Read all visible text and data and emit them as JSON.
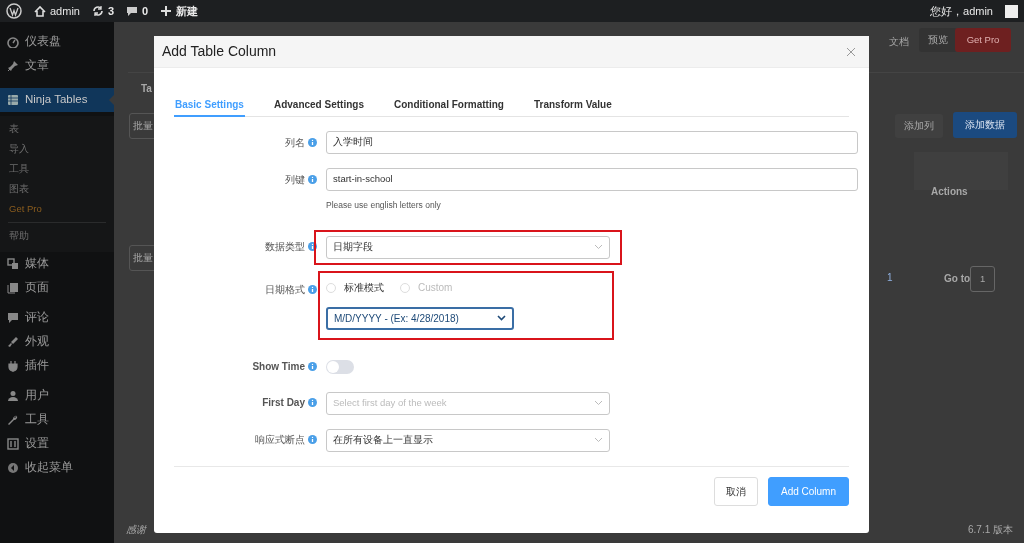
{
  "admin_bar": {
    "items": [
      {
        "kind": "home",
        "label": "admin"
      },
      {
        "kind": "updates",
        "label": "3"
      },
      {
        "kind": "comments",
        "label": "0"
      },
      {
        "kind": "new",
        "label": "新建"
      }
    ],
    "greeting": "您好，admin"
  },
  "sidebar": {
    "items": [
      {
        "kind": "dashboard",
        "label": "仪表盘",
        "selected": false
      },
      {
        "kind": "pin",
        "label": "文章",
        "selected": false
      },
      {
        "kind": "table",
        "label": "Ninja Tables",
        "selected": true,
        "children": [
          {
            "label": "表",
            "kind": "plain"
          },
          {
            "label": "导入",
            "kind": "plain"
          },
          {
            "label": "工具",
            "kind": "plain"
          },
          {
            "label": "图表",
            "kind": "plain"
          },
          {
            "label": "Get Pro",
            "kind": "pro"
          },
          {
            "label": "帮助",
            "kind": "plain"
          }
        ]
      },
      {
        "kind": "media",
        "label": "媒体",
        "selected": false
      },
      {
        "kind": "page",
        "label": "页面",
        "selected": false
      },
      {
        "kind": "comment",
        "label": "评论",
        "selected": false
      },
      {
        "kind": "brush",
        "label": "外观",
        "selected": false
      },
      {
        "kind": "plug",
        "label": "插件",
        "selected": false
      },
      {
        "kind": "user",
        "label": "用户",
        "selected": false
      },
      {
        "kind": "wrench",
        "label": "工具",
        "selected": false
      },
      {
        "kind": "settings",
        "label": "设置",
        "selected": false
      },
      {
        "kind": "collapse",
        "label": "收起菜单",
        "selected": false
      }
    ]
  },
  "background": {
    "header_links": [
      "文档",
      "预览"
    ],
    "pro_button": "Get Pro",
    "tab_fragment": "Ta",
    "bulk_fragments": [
      "批量",
      "批量"
    ],
    "add_column_button": "添加列",
    "add_data_button": "添加数据",
    "column_header": "Actions",
    "page_number": "1",
    "goto_label": "Go to",
    "goto_value": "1",
    "footer_fragment": "感谢",
    "version": "6.7.1 版本"
  },
  "modal": {
    "title": "Add Table Column",
    "tabs": [
      {
        "label": "Basic Settings",
        "selected": true
      },
      {
        "label": "Advanced Settings",
        "selected": false
      },
      {
        "label": "Conditional Formatting",
        "selected": false
      },
      {
        "label": "Transform Value",
        "selected": false
      }
    ],
    "fields": [
      {
        "kind": "text",
        "label": "列名",
        "value": "入学时间"
      },
      {
        "kind": "text",
        "label": "列键",
        "value": "start-in-school",
        "hint": "Please use english letters only"
      },
      {
        "kind": "select",
        "label": "数据类型",
        "value": "日期字段",
        "highlighted": true
      },
      {
        "kind": "date_format",
        "label": "日期格式",
        "highlighted": true,
        "options": [
          {
            "label": "标准模式",
            "selected": false,
            "disabled": false
          },
          {
            "label": "Custom",
            "selected": false,
            "disabled": true
          }
        ],
        "format": "M/D/YYYY - (Ex: 4/28/2018)"
      },
      {
        "kind": "toggle",
        "label": "Show Time",
        "on": false
      },
      {
        "kind": "select",
        "label": "First Day",
        "placeholder": "Select first day of the week"
      },
      {
        "kind": "select",
        "label": "响应式断点",
        "value": "在所有设备上一直显示"
      }
    ],
    "buttons": [
      {
        "kind": "secondary",
        "label": "取消"
      },
      {
        "kind": "primary",
        "label": "Add Column"
      }
    ]
  }
}
